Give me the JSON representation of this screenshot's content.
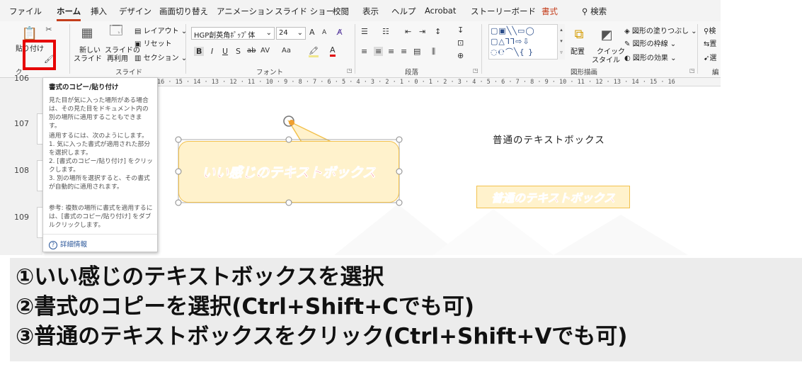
{
  "ribbon": {
    "tabs": [
      {
        "label": "ファイル",
        "active": false
      },
      {
        "label": "ホーム",
        "active": true
      },
      {
        "label": "挿入",
        "active": false
      },
      {
        "label": "デザイン",
        "active": false
      },
      {
        "label": "画面切り替え",
        "active": false
      },
      {
        "label": "アニメーション",
        "active": false
      },
      {
        "label": "スライド ショー",
        "active": false
      },
      {
        "label": "校閲",
        "active": false
      },
      {
        "label": "表示",
        "active": false
      },
      {
        "label": "ヘルプ",
        "active": false
      },
      {
        "label": "Acrobat",
        "active": false
      },
      {
        "label": "ストーリーボード",
        "active": false
      },
      {
        "label": "書式",
        "active": false
      }
    ],
    "search_label": "検索",
    "clipboard": {
      "paste_label": "貼り付け",
      "group_label": "ク"
    },
    "slides": {
      "new_slide_label_1": "新しい",
      "new_slide_label_2": "スライド",
      "reuse_label_1": "スライドの",
      "reuse_label_2": "再利用",
      "layout_label": "レイアウト",
      "reset_label": "リセット",
      "section_label": "セクション",
      "group_label": "スライド"
    },
    "font": {
      "font_name": "HGP創英角ﾎﾟｯﾌﾟ体",
      "font_size": "24",
      "group_label": "フォント",
      "bold": "B",
      "italic": "I",
      "underline": "U",
      "strike": "S",
      "abc": "ab",
      "spacing": "AV",
      "case": "Aa",
      "grow": "A",
      "shrink": "A"
    },
    "paragraph": {
      "group_label": "段落"
    },
    "drawing": {
      "group_label": "図形描画",
      "arrange_label": "配置",
      "quick_style_label_1": "クイック",
      "quick_style_label_2": "スタイル",
      "fill_label": "図形の塗りつぶし",
      "outline_label": "図形の枠線",
      "effect_label": "図形の効果"
    },
    "editing": {
      "find_label": "検",
      "replace_label": "置",
      "select_label": "選",
      "group_label": "編"
    }
  },
  "ruler": {
    "text": "16 · 15 · 14 · 13 · 12 · 11 · 10 · 9 · 8 · 7 · 6 · 5 · 4 · 3 · 2 · 1 · 0 · 1 · 2 · 3 · 4 · 5 · 6 · 7 · 8 · 9 · 10 · 11 · 12 · 13 · 14 · 15 · 16"
  },
  "thumbnails": {
    "slide_numbers": [
      "106",
      "107",
      "108",
      "109"
    ]
  },
  "tooltip": {
    "title": "書式のコピー/貼り付け",
    "description": "見た目が気に入った場所がある場合は、その見た目をドキュメント内の別の場所に適用することもできます。",
    "intro": "適用するには、次のようにします。",
    "steps": [
      "1. 気に入った書式が適用された部分を選択します。",
      "2. [書式のコピー/貼り付け] をクリックします。",
      "3. 別の場所を選択すると、その書式が自動的に適用されます。"
    ],
    "note": "参考: 複数の場所に書式を適用するには、[書式のコピー/貼り付け] をダブルクリックします。",
    "more_info": "詳細情報"
  },
  "canvas": {
    "nice_textbox": "いい感じのテキストボックス",
    "plain_textbox": "普通のテキストボックス",
    "applied_textbox": "普通のテキストボックス"
  },
  "instructions": [
    "①いい感じのテキストボックスを選択",
    "②書式のコピーを選択(Ctrl+Shift+Cでも可)",
    "③普通のテキストボックスをクリック(Ctrl+Shift+Vでも可)"
  ],
  "colors": {
    "highlight": "#e60000",
    "callout_fill": "#fff2cc",
    "callout_border": "#f2c14e",
    "styled_text": "#ff0000",
    "accent_tab": "#c43e1c"
  }
}
